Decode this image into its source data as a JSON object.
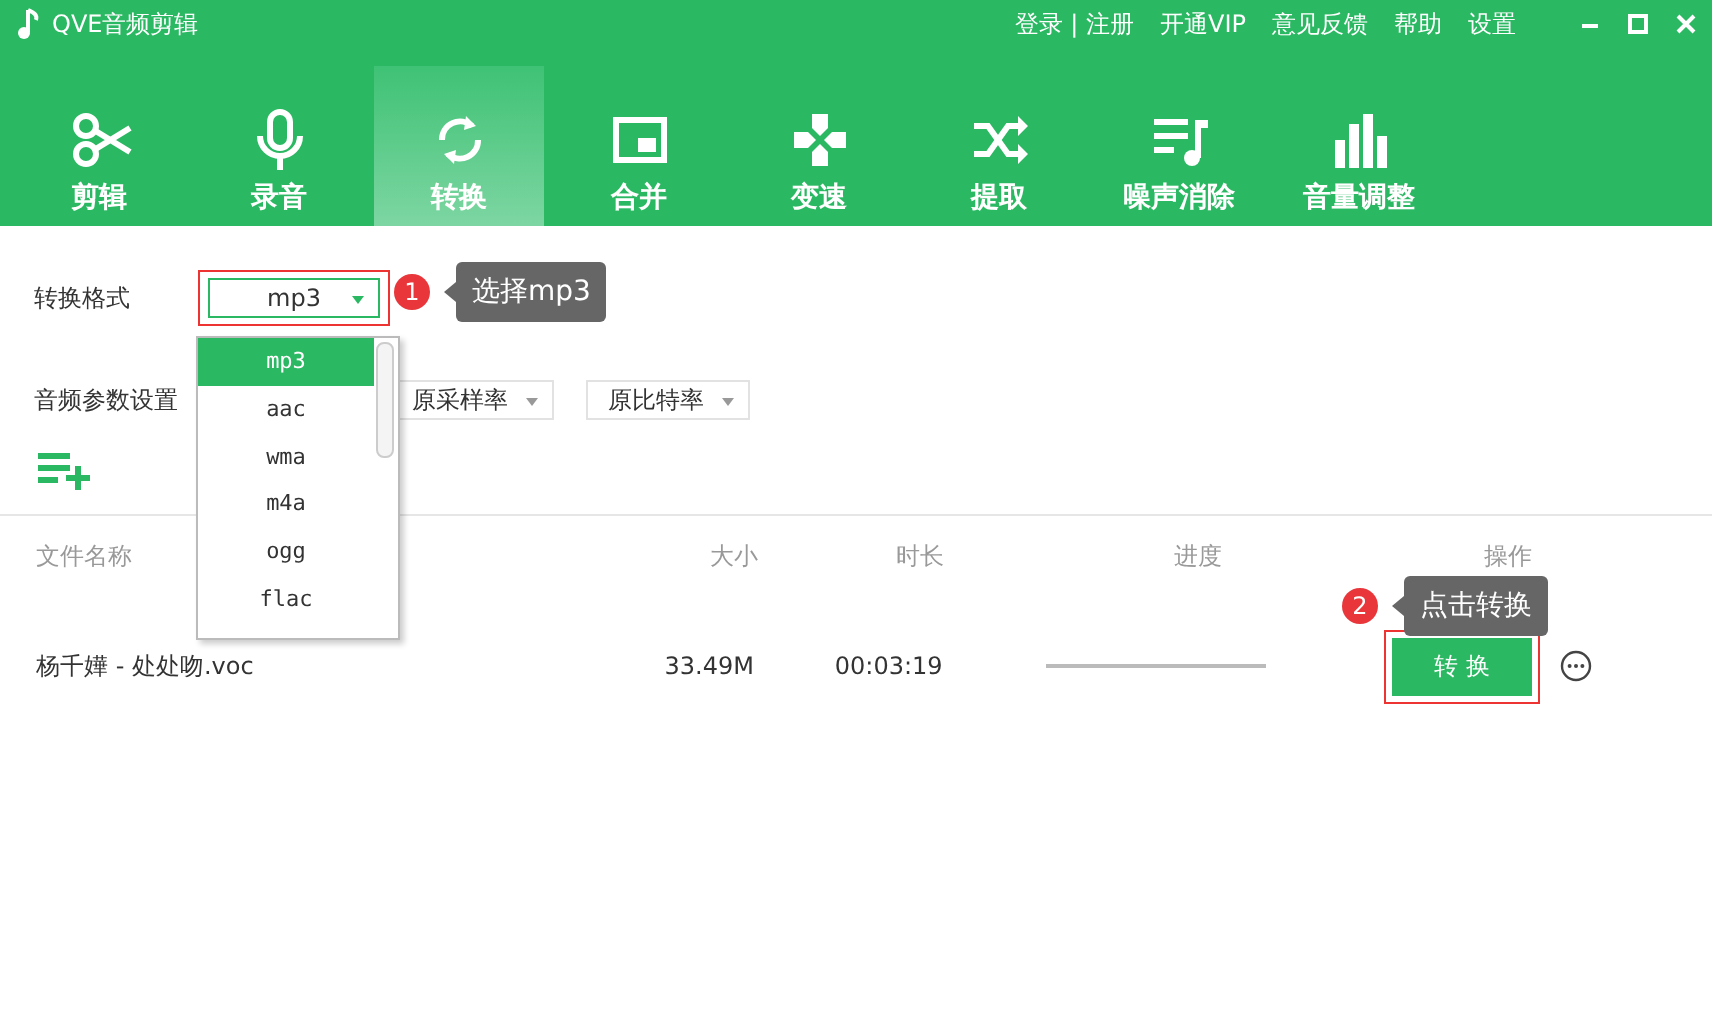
{
  "window": {
    "title": "QVE音频剪辑"
  },
  "top_links": [
    "登录 | 注册",
    "开通VIP",
    "意见反馈",
    "帮助",
    "设置"
  ],
  "tabs": [
    {
      "label": "剪辑",
      "selected": false
    },
    {
      "label": "录音",
      "selected": false
    },
    {
      "label": "转换",
      "selected": true
    },
    {
      "label": "合并",
      "selected": false
    },
    {
      "label": "变速",
      "selected": false
    },
    {
      "label": "提取",
      "selected": false
    },
    {
      "label": "噪声消除",
      "selected": false
    },
    {
      "label": "音量调整",
      "selected": false
    }
  ],
  "format": {
    "label": "转换格式",
    "value": "mp3",
    "options": [
      {
        "label": "mp3",
        "selected": true
      },
      {
        "label": "aac",
        "selected": false
      },
      {
        "label": "wma",
        "selected": false
      },
      {
        "label": "m4a",
        "selected": false
      },
      {
        "label": "ogg",
        "selected": false
      },
      {
        "label": "flac",
        "selected": false
      }
    ]
  },
  "params": {
    "label": "音频参数设置",
    "selects": [
      "原采样率",
      "原比特率"
    ]
  },
  "tips": [
    {
      "number": "1",
      "text": "选择mp3"
    },
    {
      "number": "2",
      "text": "点击转换"
    }
  ],
  "table": {
    "columns": [
      "文件名称",
      "大小",
      "时长",
      "进度",
      "操作"
    ],
    "rows": [
      {
        "name": "杨千嬅 - 处处吻.voc",
        "size": "33.49M",
        "duration": "00:03:19",
        "level": 0,
        "action": "转 换"
      }
    ]
  }
}
